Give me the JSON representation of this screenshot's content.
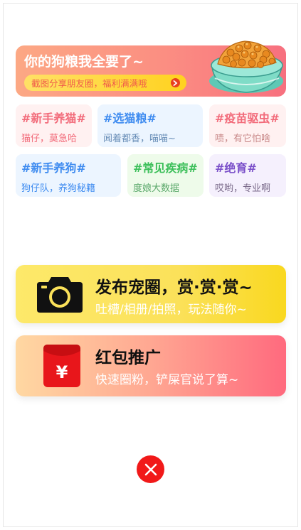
{
  "banner": {
    "title": "你的狗粮我全要了~",
    "pill_text": "截图分享朋友圈，福利满满哦",
    "arrow_icon": "chevron-right-circle-icon",
    "image": "dog-food-bowl"
  },
  "tags": [
    {
      "title": "#新手养猫#",
      "sub": "猫仔，莫急哈",
      "color": "#f26b7a",
      "bg": "#fff1f1"
    },
    {
      "title": "#选猫粮#",
      "sub": "闻着都香，喵喵~",
      "color": "#3f8cf0",
      "bg": "#ecf5ff"
    },
    {
      "title": "#疫苗驱虫#",
      "sub": "啧，有它怕啥",
      "color": "#f26b7a",
      "bg": "#fff1f1"
    },
    {
      "title": "#新手养狗#",
      "sub": "狗仔队，养狗秘籍",
      "color": "#3f8cf0",
      "bg": "#ecf5ff"
    },
    {
      "title": "#常见疾病#",
      "sub": "度娘大数据",
      "color": "#3cbf5a",
      "bg": "#eefbea"
    },
    {
      "title": "#绝育#",
      "sub": "哎哟，专业啊",
      "color": "#7a4fc9",
      "bg": "#f5f0fd"
    }
  ],
  "post_card": {
    "title": "发布宠圈，赏·赏·赏~",
    "sub": "吐槽/相册/拍照，玩法随你~",
    "icon": "camera-icon"
  },
  "redpacket_card": {
    "title": "红包推广",
    "sub": "快速圈粉，铲屎官说了算~",
    "icon": "red-envelope-icon",
    "icon_symbol": "¥"
  },
  "close": {
    "icon": "close-icon"
  },
  "colors": {
    "accent_red": "#f11919",
    "banner_pink": "#fb8e82",
    "pill_yellow": "#ffd21f"
  }
}
